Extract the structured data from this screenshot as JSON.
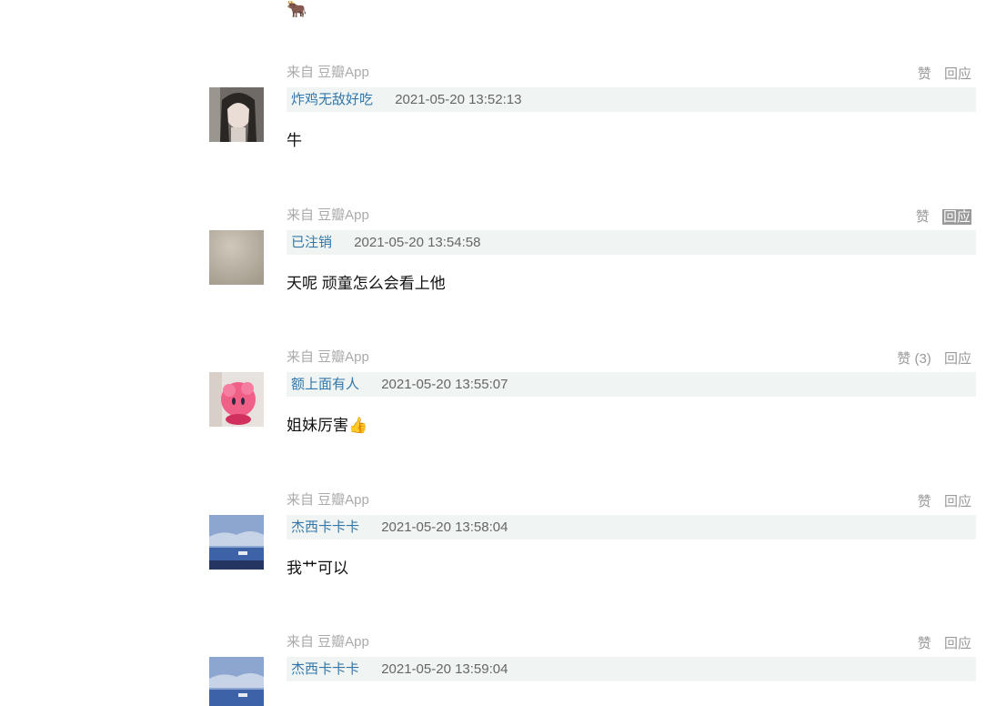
{
  "top_emoji": "🐂",
  "comments": [
    {
      "source": "来自 豆瓣App",
      "like": "赞",
      "reply": "回应",
      "author": "炸鸡无敌好吃",
      "time": "2021-05-20 13:52:13",
      "text": "牛"
    },
    {
      "source": "来自 豆瓣App",
      "like": "赞",
      "reply": "回应",
      "author": "已注销",
      "time": "2021-05-20 13:54:58",
      "text": "天呢 顽童怎么会看上他"
    },
    {
      "source": "来自 豆瓣App",
      "like": "赞 (3)",
      "reply": "回应",
      "author": "额上面有人",
      "time": "2021-05-20 13:55:07",
      "text": "姐妹厉害👍"
    },
    {
      "source": "来自 豆瓣App",
      "like": "赞",
      "reply": "回应",
      "author": "杰西卡卡卡",
      "time": "2021-05-20 13:58:04",
      "text": "我艹可以"
    },
    {
      "source": "来自 豆瓣App",
      "like": "赞",
      "reply": "回应",
      "author": "杰西卡卡卡",
      "time": "2021-05-20 13:59:04",
      "text": ""
    }
  ]
}
